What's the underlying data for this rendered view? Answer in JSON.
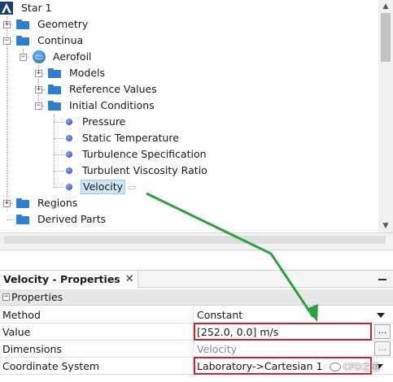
{
  "tree": {
    "root": "Star 1",
    "geometry": "Geometry",
    "continua": "Continua",
    "aerofoil": "Aerofoil",
    "models": "Models",
    "reference_values": "Reference Values",
    "initial_conditions": "Initial Conditions",
    "pressure": "Pressure",
    "static_temperature": "Static Temperature",
    "turbulence_specification": "Turbulence Specification",
    "turbulent_viscosity_ratio": "Turbulent Viscosity Ratio",
    "velocity": "Velocity",
    "regions": "Regions",
    "derived_parts": "Derived Parts"
  },
  "expanders": {
    "plus": "+",
    "minus": "−"
  },
  "properties": {
    "tab_title": "Velocity - Properties",
    "close_glyph": "✕",
    "section": "Properties",
    "rows": [
      {
        "name": "Method",
        "value": "Constant"
      },
      {
        "name": "Value",
        "value": "[252.0, 0.0] m/s"
      },
      {
        "name": "Dimensions",
        "value": "Velocity"
      },
      {
        "name": "Coordinate System",
        "value": "Laboratory->Cartesian 1"
      }
    ],
    "ellipsis": "..."
  },
  "watermark": "CFD之道",
  "colors": {
    "annotation_arrow": "#2ea043",
    "highlight_box": "#d0242b",
    "folder": "#2f7fd1",
    "selection": "#cfe6f4"
  }
}
